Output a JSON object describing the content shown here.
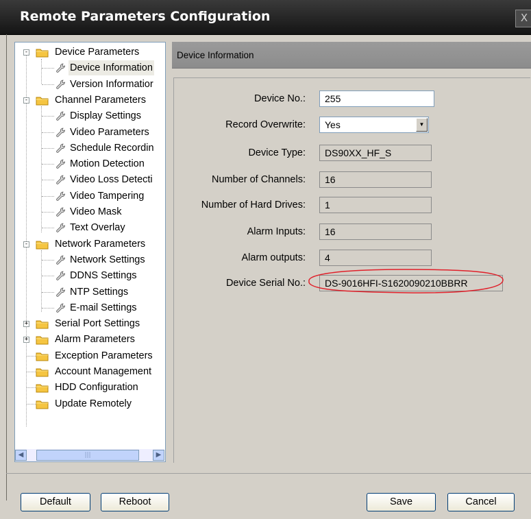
{
  "window": {
    "title": "Remote Parameters Configuration",
    "close_label": "X"
  },
  "tree": [
    {
      "label": "Device Parameters",
      "type": "folder",
      "expander": "-"
    },
    {
      "label": "Device Information",
      "type": "leaf",
      "selected": true
    },
    {
      "label": "Version Informatior",
      "type": "leaf"
    },
    {
      "label": "Channel Parameters",
      "type": "folder",
      "expander": "-"
    },
    {
      "label": "Display Settings",
      "type": "leaf"
    },
    {
      "label": "Video Parameters",
      "type": "leaf"
    },
    {
      "label": "Schedule Recordin",
      "type": "leaf"
    },
    {
      "label": "Motion Detection",
      "type": "leaf"
    },
    {
      "label": "Video Loss Detecti",
      "type": "leaf"
    },
    {
      "label": "Video Tampering",
      "type": "leaf"
    },
    {
      "label": "Video Mask",
      "type": "leaf"
    },
    {
      "label": "Text Overlay",
      "type": "leaf"
    },
    {
      "label": "Network Parameters",
      "type": "folder",
      "expander": "-"
    },
    {
      "label": "Network Settings",
      "type": "leaf"
    },
    {
      "label": "DDNS Settings",
      "type": "leaf"
    },
    {
      "label": "NTP Settings",
      "type": "leaf"
    },
    {
      "label": "E-mail Settings",
      "type": "leaf"
    },
    {
      "label": "Serial Port Settings",
      "type": "folder",
      "expander": "+"
    },
    {
      "label": "Alarm Parameters",
      "type": "folder",
      "expander": "+"
    },
    {
      "label": "Exception Parameters",
      "type": "folder"
    },
    {
      "label": "Account Management",
      "type": "folder"
    },
    {
      "label": "HDD Configuration",
      "type": "folder"
    },
    {
      "label": "Update Remotely",
      "type": "folder"
    }
  ],
  "panel": {
    "header": "Device Information",
    "fields": [
      {
        "label": "Device No.:",
        "value": "255",
        "kind": "editable"
      },
      {
        "label": "Record Overwrite:",
        "value": "Yes",
        "kind": "select"
      },
      {
        "label": "Device Type:",
        "value": "DS90XX_HF_S",
        "kind": "readonly"
      },
      {
        "label": "Number of Channels:",
        "value": "16",
        "kind": "readonly"
      },
      {
        "label": "Number of Hard Drives:",
        "value": "1",
        "kind": "readonly"
      },
      {
        "label": "Alarm Inputs:",
        "value": "16",
        "kind": "readonly"
      },
      {
        "label": "Alarm outputs:",
        "value": "4",
        "kind": "readonly"
      },
      {
        "label": "Device Serial No.:",
        "value": "DS-9016HFI-S1620090210BBRR",
        "kind": "readonly"
      }
    ]
  },
  "buttons": {
    "default": "Default",
    "reboot": "Reboot",
    "save": "Save",
    "cancel": "Cancel"
  },
  "colors": {
    "annotation_circle": "#e0202a",
    "folder": "#f5c542"
  }
}
